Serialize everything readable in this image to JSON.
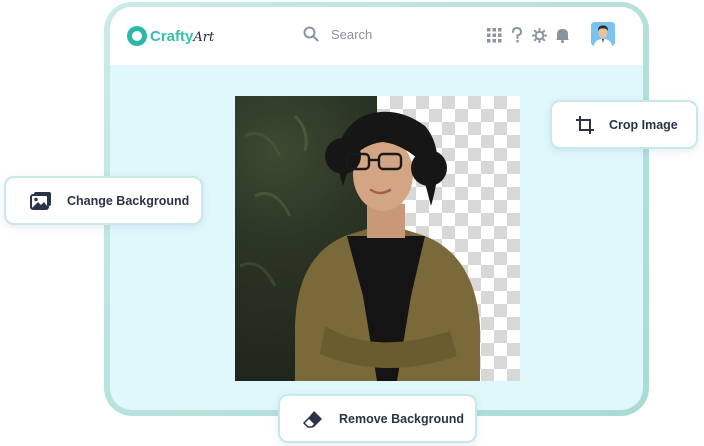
{
  "app": {
    "logo": {
      "part1": "Crafty",
      "part2": "Art"
    },
    "search": {
      "placeholder": "Search"
    },
    "toolbar_icons": [
      "apps-grid-icon",
      "help-icon",
      "settings-icon",
      "notifications-icon"
    ]
  },
  "actions": {
    "crop_image": "Crop Image",
    "change_background": "Change Background",
    "remove_background": "Remove Background"
  },
  "colors": {
    "brand_teal": "#2ab8a8",
    "canvas_bg": "#e0f8fb",
    "frame_gradient": "#b9e3dc",
    "text_dark": "#2a3446"
  }
}
